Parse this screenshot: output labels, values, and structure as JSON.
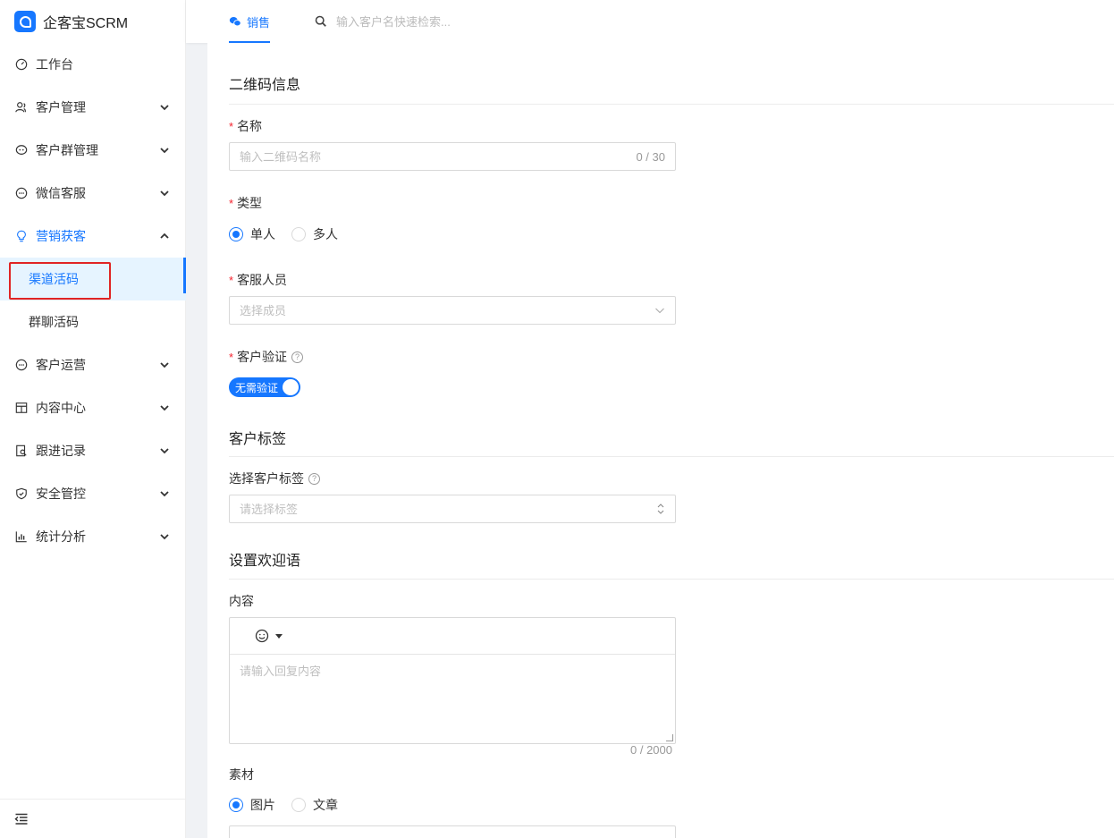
{
  "brand": {
    "title": "企客宝SCRM"
  },
  "topbar": {
    "tab_label": "销售",
    "search_placeholder": "输入客户名快速检索..."
  },
  "sidebar": {
    "items": [
      {
        "label": "工作台",
        "icon": "dashboard-icon"
      },
      {
        "label": "客户管理",
        "icon": "users-icon"
      },
      {
        "label": "客户群管理",
        "icon": "chat-group-icon"
      },
      {
        "label": "微信客服",
        "icon": "wechat-service-icon"
      },
      {
        "label": "营销获客",
        "icon": "lightbulb-icon"
      },
      {
        "label": "客户运营",
        "icon": "ops-icon"
      },
      {
        "label": "内容中心",
        "icon": "content-icon"
      },
      {
        "label": "跟进记录",
        "icon": "record-icon"
      },
      {
        "label": "安全管控",
        "icon": "shield-icon"
      },
      {
        "label": "统计分析",
        "icon": "chart-icon"
      }
    ],
    "subitems": [
      {
        "label": "渠道活码"
      },
      {
        "label": "群聊活码"
      }
    ]
  },
  "form": {
    "section_qr": "二维码信息",
    "name_label": "名称",
    "name_placeholder": "输入二维码名称",
    "name_count": "0 / 30",
    "type_label": "类型",
    "type_options": [
      "单人",
      "多人"
    ],
    "staff_label": "客服人员",
    "staff_placeholder": "选择成员",
    "verify_label": "客户验证",
    "verify_switch_text": "无需验证",
    "section_tags": "客户标签",
    "tags_label": "选择客户标签",
    "tags_placeholder": "请选择标签",
    "section_welcome": "设置欢迎语",
    "content_label": "内容",
    "content_placeholder": "请输入回复内容",
    "content_count": "0 / 2000",
    "material_label": "素材",
    "material_options": [
      "图片",
      "文章"
    ]
  },
  "colors": {
    "accent": "#1677ff",
    "required": "#f5222d",
    "highlight": "#e02424"
  }
}
